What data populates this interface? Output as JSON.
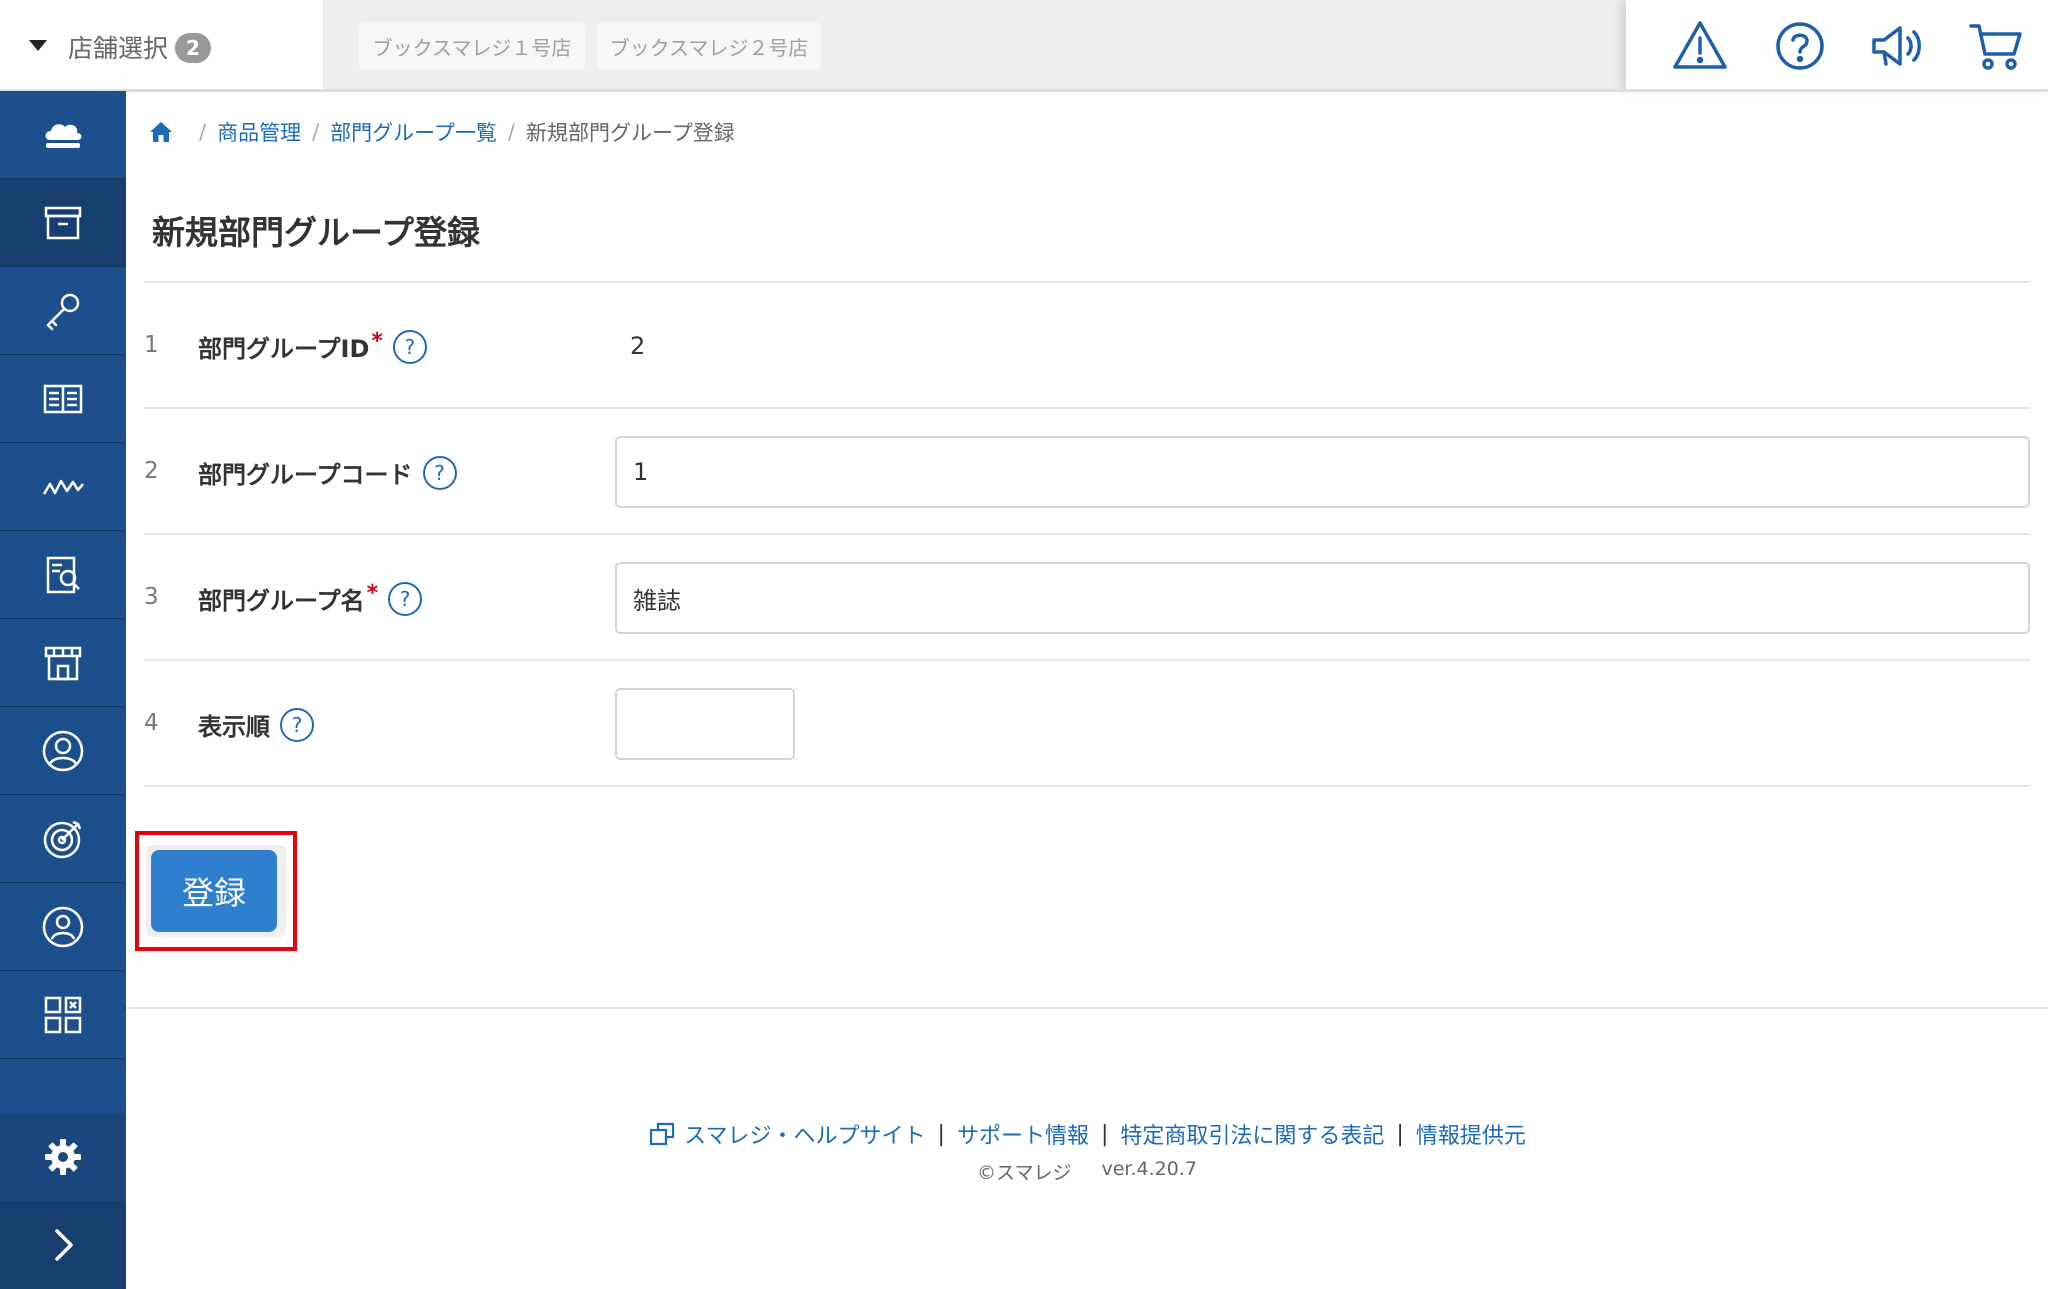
{
  "header": {
    "store_select_label": "店舗選択",
    "store_count": "2",
    "stores": [
      "ブックスマレジ１号店",
      "ブックスマレジ２号店"
    ],
    "icons": [
      "warning-icon",
      "help-icon",
      "megaphone-icon",
      "cart-icon"
    ]
  },
  "sidebar": {
    "items": [
      "cloud-icon",
      "archive-box-icon",
      "key-icon",
      "book-icon",
      "chart-icon",
      "report-search-icon",
      "store-icon",
      "customer-icon",
      "target-icon",
      "staff-icon",
      "apps-grid-icon"
    ],
    "active_index": 1,
    "bottom": [
      "settings-icon",
      "expand-icon"
    ]
  },
  "breadcrumb": {
    "items": [
      "商品管理",
      "部門グループ一覧"
    ],
    "current": "新規部門グループ登録"
  },
  "page_title": "新規部門グループ登録",
  "form": {
    "rows": [
      {
        "num": "1",
        "label": "部門グループID",
        "required_mark": "*",
        "help": "?",
        "value": "2"
      },
      {
        "num": "2",
        "label": "部門グループコード",
        "help": "?",
        "value": "1"
      },
      {
        "num": "3",
        "label": "部門グループ名",
        "required_mark": "*",
        "help": "?",
        "value": "雑誌"
      },
      {
        "num": "4",
        "label": "表示順",
        "help": "?",
        "value": ""
      }
    ],
    "submit_label": "登録"
  },
  "footer": {
    "links": [
      "スマレジ・ヘルプサイト",
      "サポート情報",
      "特定商取引法に関する表記",
      "情報提供元"
    ],
    "separator": "|",
    "copyright": "©スマレジ",
    "version": "ver.4.20.7"
  }
}
